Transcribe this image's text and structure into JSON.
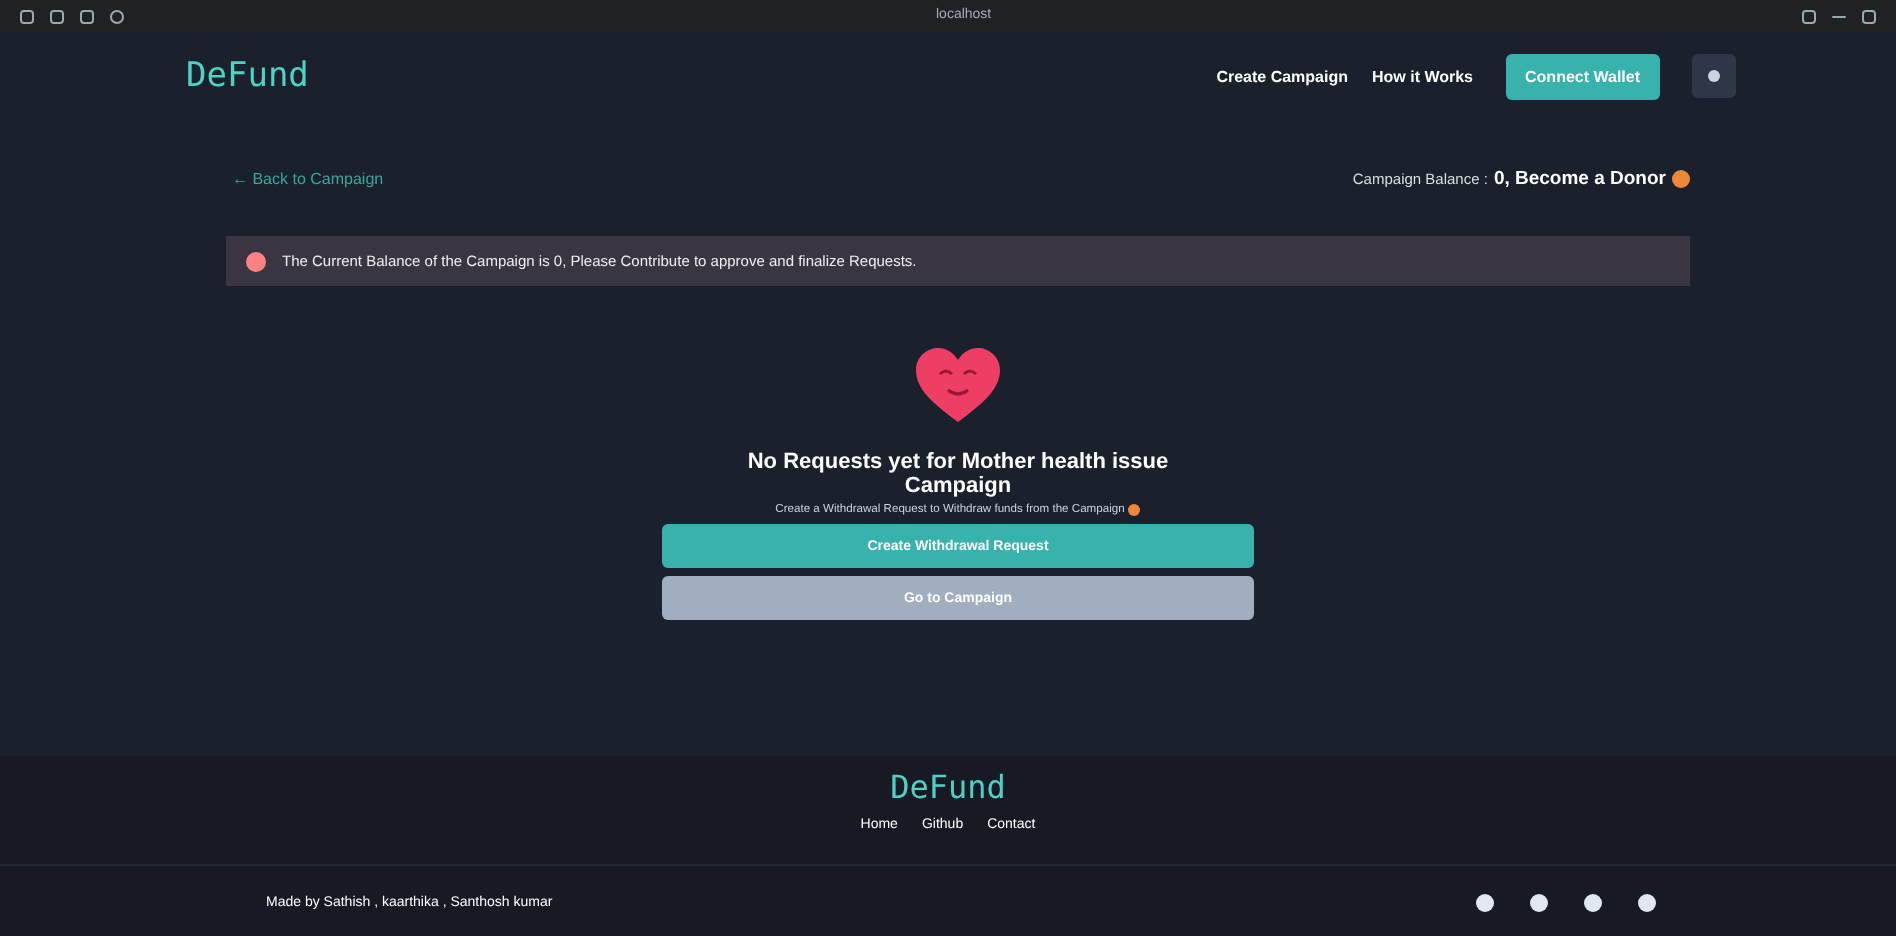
{
  "browser": {
    "address": "localhost"
  },
  "header": {
    "logo": "DeFund",
    "nav": [
      "Create Campaign",
      "How it Works"
    ],
    "connect_button": "Connect Wallet"
  },
  "back_link": "← Back to Campaign",
  "balance": {
    "label": "Campaign Balance :",
    "value": "0, Become a Donor"
  },
  "alert": {
    "text": "The Current Balance of the Campaign is 0, Please Contribute to approve and finalize Requests."
  },
  "empty_state": {
    "title": "No Requests yet for Mother health issue Campaign",
    "subtitle": "Create a Withdrawal Request to Withdraw funds from the Campaign"
  },
  "buttons": [
    {
      "label": "Create Withdrawal Request",
      "kind": "primary"
    },
    {
      "label": "Go to Campaign",
      "kind": "secondary"
    }
  ],
  "footer": {
    "logo": "DeFund",
    "links": [
      "Home",
      "Github",
      "Contact"
    ],
    "credits": "Made by Sathish , kaarthika , Santhosh kumar"
  }
}
